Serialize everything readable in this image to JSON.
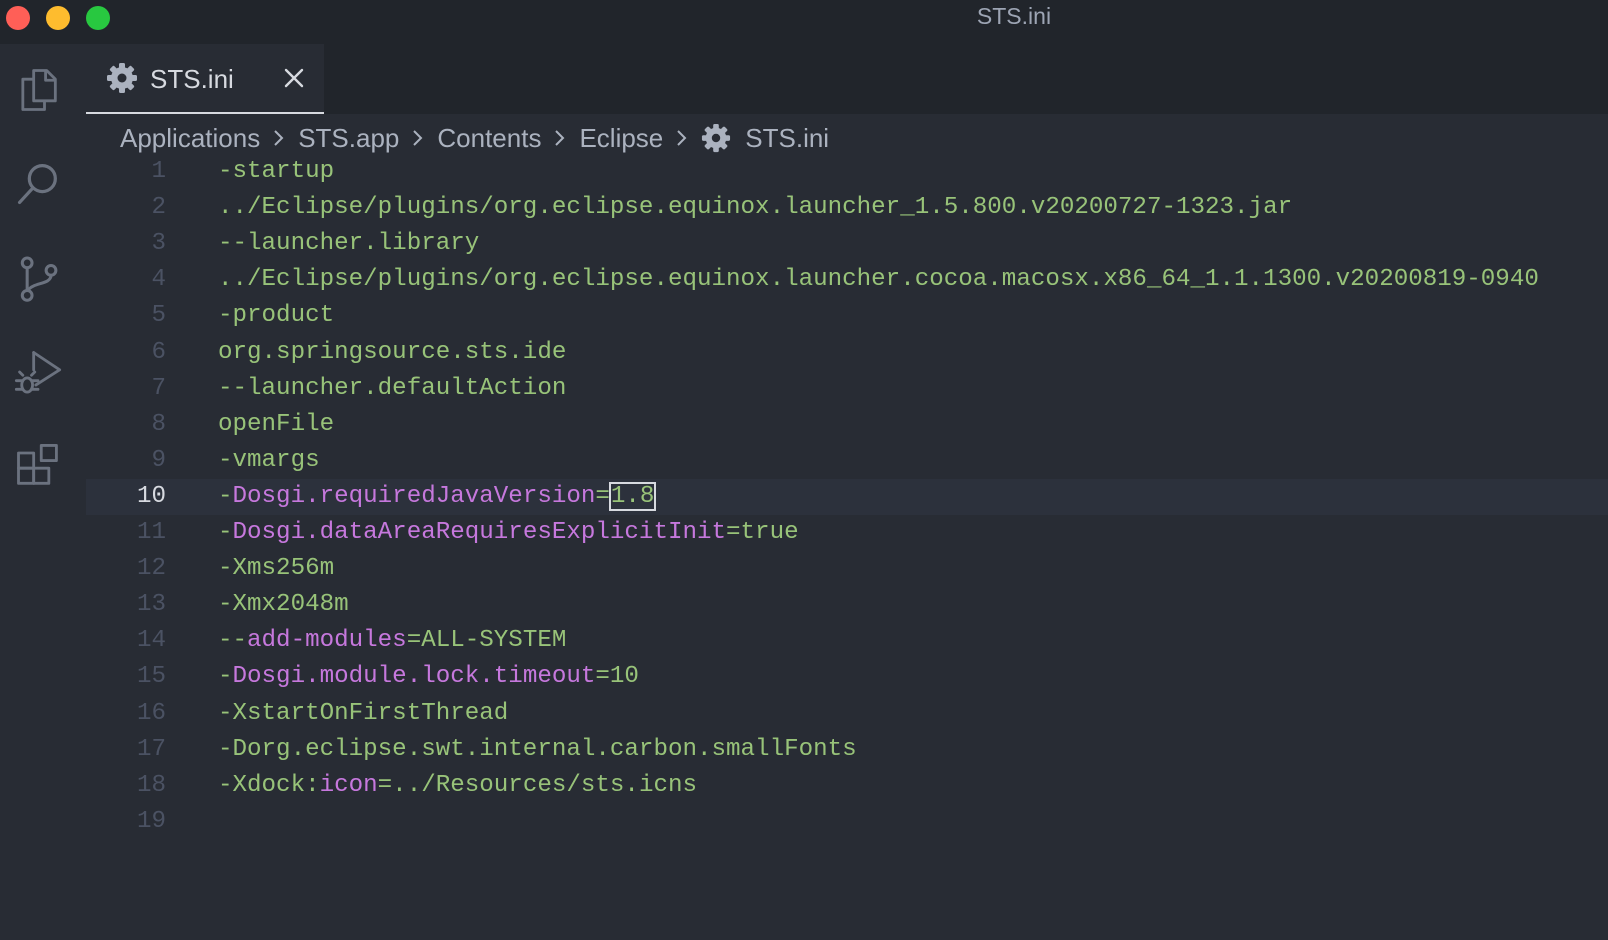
{
  "window": {
    "title": "STS.ini"
  },
  "activity_bar": {
    "icons": [
      "explorer-icon",
      "search-icon",
      "source-control-icon",
      "run-debug-icon",
      "extensions-icon"
    ]
  },
  "tab": {
    "icon": "gear-icon",
    "label": "STS.ini",
    "close_icon": "close-icon"
  },
  "breadcrumb": {
    "items": [
      "Applications",
      "STS.app",
      "Contents",
      "Eclipse",
      "STS.ini"
    ],
    "file_icon": "gear-icon"
  },
  "editor": {
    "current_line": 10,
    "lines": [
      {
        "n": "1",
        "t": [
          {
            "k": "p",
            "v": "-startup"
          }
        ]
      },
      {
        "n": "2",
        "t": [
          {
            "k": "p",
            "v": "../Eclipse/plugins/org.eclipse.equinox.launcher_1.5.800.v20200727-1323.jar"
          }
        ]
      },
      {
        "n": "3",
        "t": [
          {
            "k": "p",
            "v": "--launcher.library"
          }
        ]
      },
      {
        "n": "4",
        "t": [
          {
            "k": "p",
            "v": "../Eclipse/plugins/org.eclipse.equinox.launcher.cocoa.macosx.x86_64_1.1.1300.v20200819-0940"
          }
        ]
      },
      {
        "n": "5",
        "t": [
          {
            "k": "p",
            "v": "-product"
          }
        ]
      },
      {
        "n": "6",
        "t": [
          {
            "k": "p",
            "v": "org.springsource.sts.ide"
          }
        ]
      },
      {
        "n": "7",
        "t": [
          {
            "k": "p",
            "v": "--launcher.defaultAction"
          }
        ]
      },
      {
        "n": "8",
        "t": [
          {
            "k": "p",
            "v": "openFile"
          }
        ]
      },
      {
        "n": "9",
        "t": [
          {
            "k": "p",
            "v": "-vmargs"
          }
        ]
      },
      {
        "n": "10",
        "t": [
          {
            "k": "p",
            "v": "-"
          },
          {
            "k": "k",
            "v": "Dosgi.requiredJavaVersion"
          },
          {
            "k": "p",
            "v": "="
          },
          {
            "k": "s",
            "v": "1.8"
          }
        ]
      },
      {
        "n": "11",
        "t": [
          {
            "k": "p",
            "v": "-"
          },
          {
            "k": "k",
            "v": "Dosgi.dataAreaRequiresExplicitInit"
          },
          {
            "k": "p",
            "v": "=true"
          }
        ]
      },
      {
        "n": "12",
        "t": [
          {
            "k": "p",
            "v": "-Xms256m"
          }
        ]
      },
      {
        "n": "13",
        "t": [
          {
            "k": "p",
            "v": "-Xmx2048m"
          }
        ]
      },
      {
        "n": "14",
        "t": [
          {
            "k": "p",
            "v": "--"
          },
          {
            "k": "k",
            "v": "add-modules"
          },
          {
            "k": "p",
            "v": "=ALL-SYSTEM"
          }
        ]
      },
      {
        "n": "15",
        "t": [
          {
            "k": "p",
            "v": "-"
          },
          {
            "k": "k",
            "v": "Dosgi.module.lock.timeout"
          },
          {
            "k": "p",
            "v": "=10"
          }
        ]
      },
      {
        "n": "16",
        "t": [
          {
            "k": "p",
            "v": "-XstartOnFirstThread"
          }
        ]
      },
      {
        "n": "17",
        "t": [
          {
            "k": "p",
            "v": "-Dorg.eclipse.swt.internal.carbon.smallFonts"
          }
        ]
      },
      {
        "n": "18",
        "t": [
          {
            "k": "p",
            "v": "-Xdock:"
          },
          {
            "k": "k",
            "v": "icon"
          },
          {
            "k": "p",
            "v": "=../Resources/sts.icns"
          }
        ]
      },
      {
        "n": "19",
        "t": []
      }
    ]
  }
}
